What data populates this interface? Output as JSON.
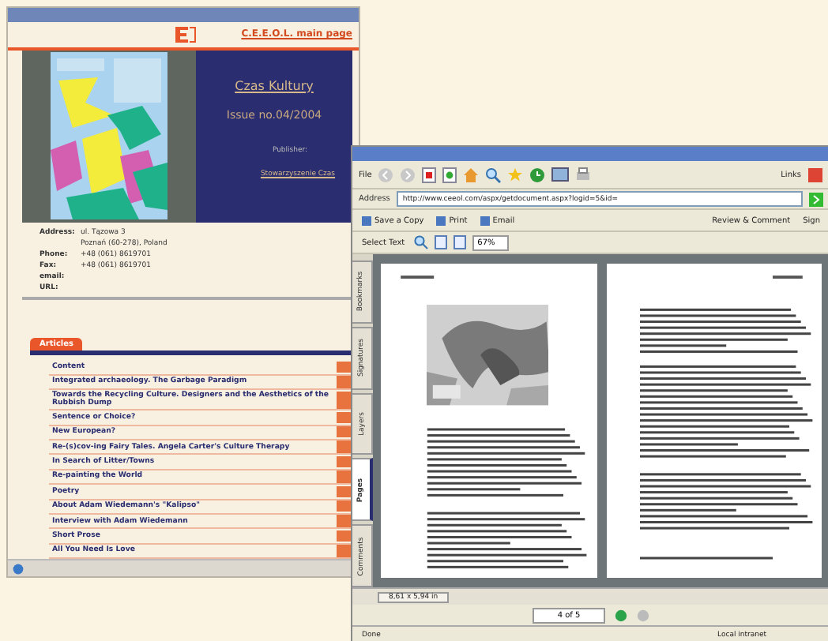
{
  "left_window": {
    "header_link": "C.E.E.O.L. main page",
    "magazine": {
      "title": "Czas Kultury",
      "issue": "Issue no.04/2004",
      "publisher_label": "Publisher:",
      "publisher_link": "Stowarzyszenie Czas"
    },
    "contact": [
      {
        "label": "Address:",
        "value": "ul. Tązowa 3"
      },
      {
        "value": "Poznań (60-278), Poland"
      },
      {
        "label": "Phone:",
        "value": "+48 (061) 8619701"
      },
      {
        "label": "Fax:",
        "value": "+48 (061) 8619701"
      },
      {
        "label": "email:"
      },
      {
        "label": "URL:"
      }
    ],
    "articles_tab": "Articles",
    "articles": [
      "Content",
      "Integrated archaeology. The Garbage Paradigm",
      "Towards the Recycling Culture. Designers and the Aesthetics of the Rubbish Dump",
      "Sentence or Choice?",
      "New European?",
      "Re-(s)cov-ing Fairy Tales. Angela Carter's Culture Therapy",
      "In Search of Litter/Towns",
      "Re-painting the World",
      "Poetry",
      "About Adam Wiedemann's \"Kalipso\"",
      "Interview with Adam Wiedemann",
      "Short Prose",
      "All You Need Is Love"
    ]
  },
  "right_window": {
    "menu": "File",
    "links_label": "Links",
    "address_label": "Address",
    "address": "http://www.ceeol.com/aspx/getdocument.aspx?logid=5&id=",
    "acrobat_buttons": [
      "Save a Copy",
      "Print",
      "Email"
    ],
    "review": "Review & Comment",
    "sign": "Sign",
    "select_text": "Select Text",
    "zoom": "67%",
    "side_tabs": [
      {
        "label": "Bookmarks",
        "selected": false
      },
      {
        "label": "Signatures",
        "selected": false
      },
      {
        "label": "Layers",
        "selected": false
      },
      {
        "label": "Pages",
        "selected": true
      },
      {
        "label": "Comments",
        "selected": false
      }
    ],
    "page_size": "8,61 x 5,94 in",
    "page_indicator": "4 of 5",
    "status": "Done",
    "zone": "Local intranet"
  }
}
